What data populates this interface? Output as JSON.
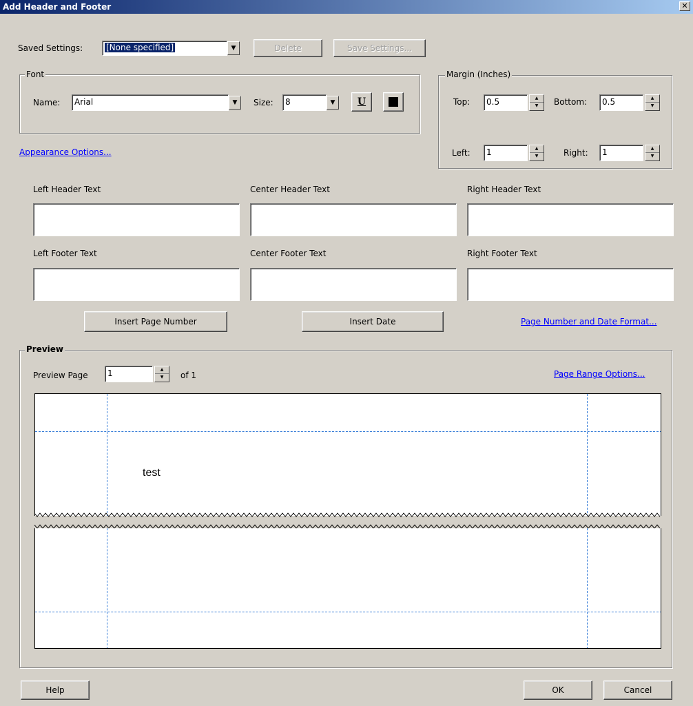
{
  "window": {
    "title": "Add Header and Footer",
    "close_glyph": "✕"
  },
  "saved_settings": {
    "label": "Saved Settings:",
    "value": "[None specified]",
    "delete_label": "Delete",
    "save_label": "Save Settings..."
  },
  "font": {
    "group_title": "Font",
    "name_label": "Name:",
    "name_value": "Arial",
    "size_label": "Size:",
    "size_value": "8",
    "underline_label": "U",
    "color": "#000000"
  },
  "margin": {
    "group_title": "Margin (Inches)",
    "top_label": "Top:",
    "top_value": "0.5",
    "bottom_label": "Bottom:",
    "bottom_value": "0.5",
    "left_label": "Left:",
    "left_value": "1",
    "right_label": "Right:",
    "right_value": "1"
  },
  "appearance_link": "Appearance Options...",
  "text_fields": {
    "left_header": {
      "label": "Left Header Text",
      "value": ""
    },
    "center_header": {
      "label": "Center Header Text",
      "value": ""
    },
    "right_header": {
      "label": "Right Header Text",
      "value": ""
    },
    "left_footer": {
      "label": "Left Footer Text",
      "value": ""
    },
    "center_footer": {
      "label": "Center Footer Text",
      "value": ""
    },
    "right_footer": {
      "label": "Right Footer Text",
      "value": ""
    }
  },
  "actions": {
    "insert_page_number": "Insert Page Number",
    "insert_date": "Insert Date",
    "format_link": "Page Number and Date Format..."
  },
  "preview": {
    "group_title": "Preview",
    "page_label": "Preview Page",
    "page_value": "1",
    "of_label": "of 1",
    "range_link": "Page Range Options...",
    "sample_text": "test"
  },
  "footer_buttons": {
    "help": "Help",
    "ok": "OK",
    "cancel": "Cancel"
  },
  "colors": {
    "titlebar_start": "#0a246a",
    "link": "#0000ff",
    "guide": "#3a7fd8",
    "dialog": "#d4d0c8"
  }
}
